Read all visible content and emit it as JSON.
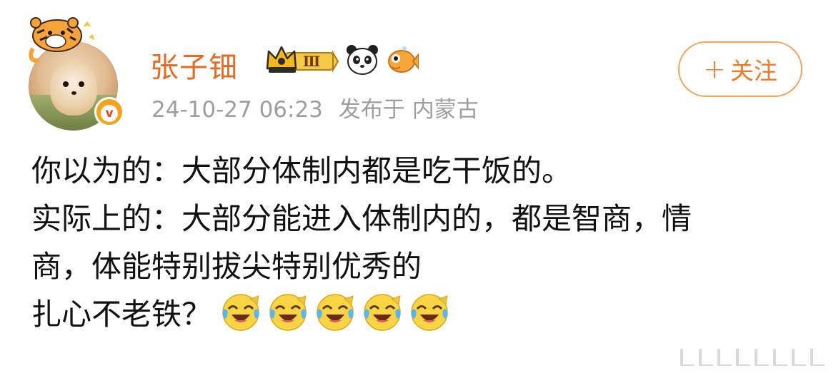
{
  "post": {
    "username": "张子钿",
    "vip_level": "Ⅲ",
    "timestamp": "24-10-27 06:23",
    "location_label": "发布于 内蒙古",
    "follow_button": {
      "plus": "+",
      "label": "关注"
    },
    "verified_mark": "v",
    "lines": [
      "你以为的：大部分体制内都是吃干饭的。",
      "实际上的：大部分能进入体制内的，都是智商，情",
      "商，体能特别拔尖特别优秀的",
      "扎心不老铁？"
    ],
    "emoji": [
      "laugh-cry",
      "laugh-cry",
      "laugh-cry",
      "laugh-cry",
      "laugh-cry"
    ]
  },
  "colors": {
    "username": "#e66a22",
    "meta": "#9e9e9e",
    "follow_border": "#f3a35c",
    "follow_text": "#ee7a2a",
    "verified": "#f7a21b"
  },
  "icons": [
    "tiger-sticker-icon",
    "verified-badge-icon",
    "crown-badge-icon",
    "panda-icon",
    "fish-icon",
    "laugh-cry-icon"
  ]
}
